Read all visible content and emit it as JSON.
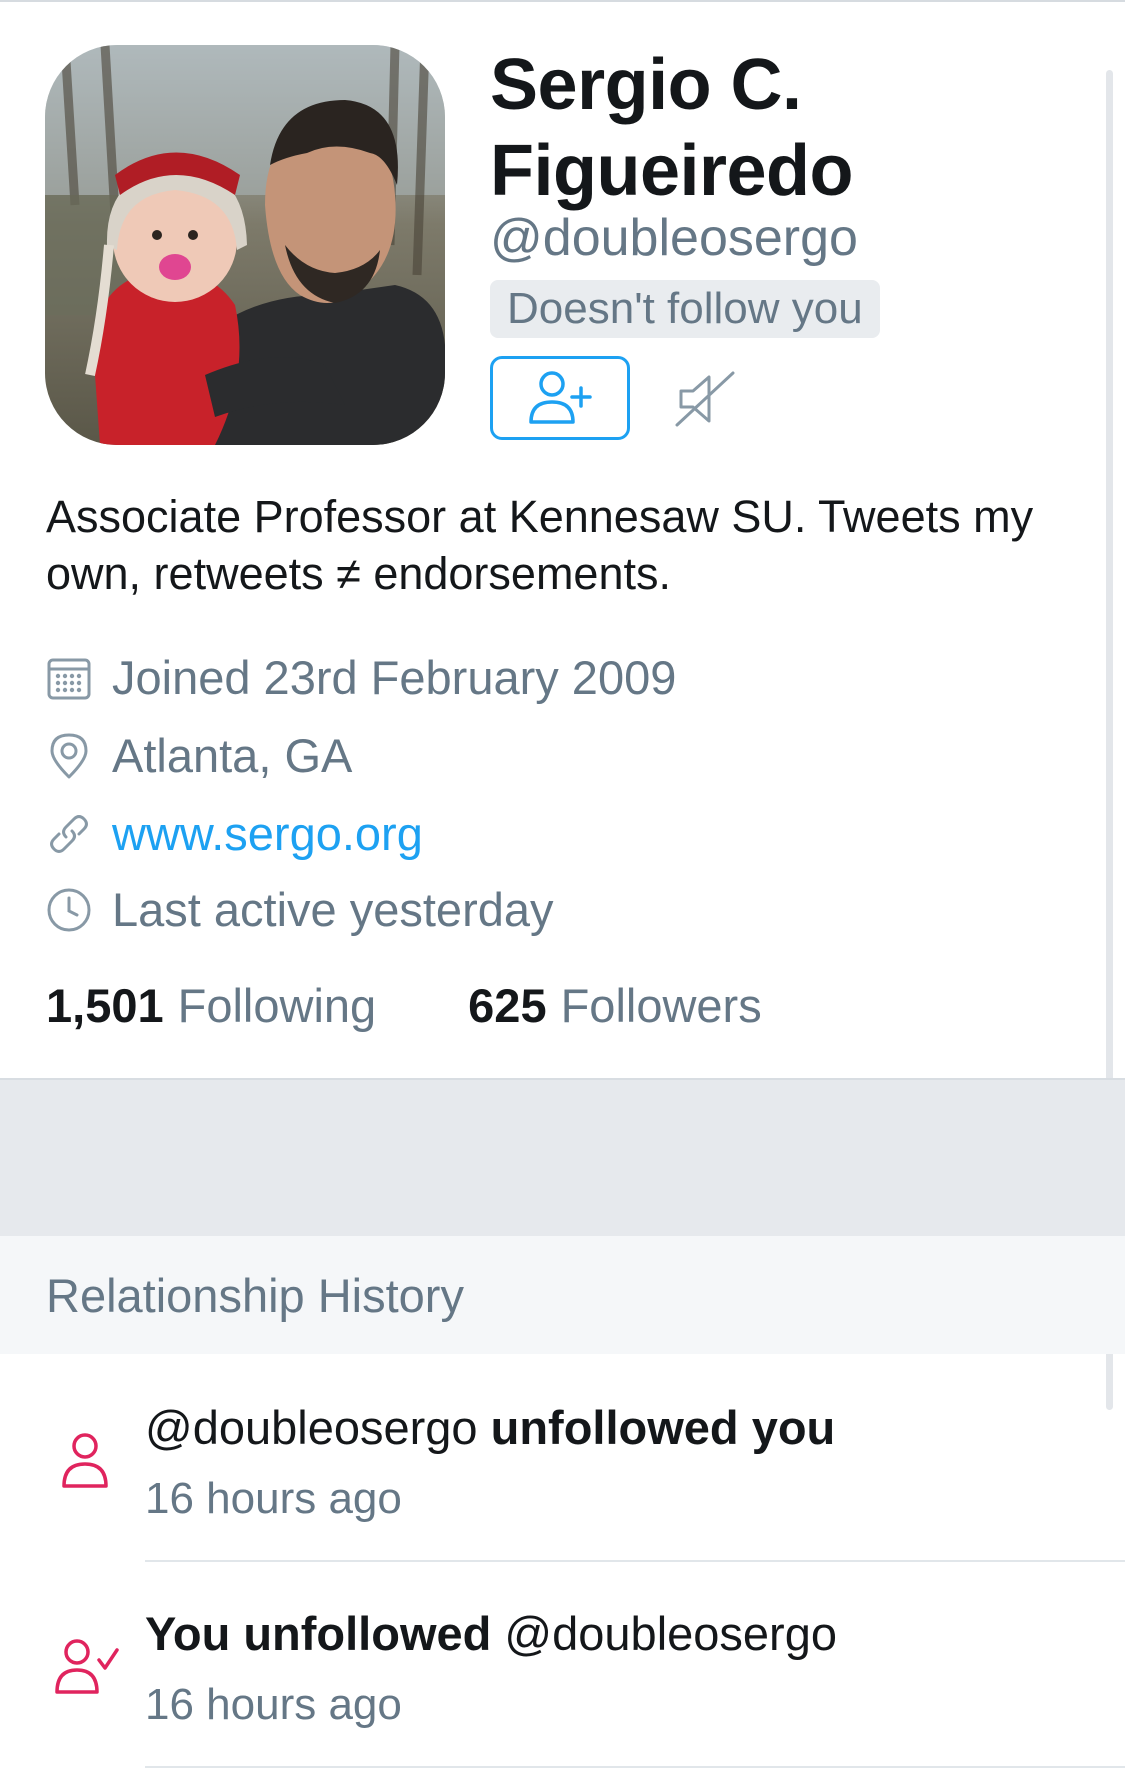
{
  "profile": {
    "name": "Sergio C. Figueiredo",
    "handle": "@doubleosergo",
    "relationship_badge": "Doesn't follow you",
    "bio": "Associate Professor at Kennesaw SU. Tweets my own, retweets ≠ endorsements.",
    "joined": "Joined 23rd February 2009",
    "location": "Atlanta, GA",
    "website": "www.sergo.org",
    "last_active": "Last active yesterday",
    "following_count": "1,501",
    "following_label": "Following",
    "followers_count": "625",
    "followers_label": "Followers"
  },
  "icons": {
    "follow": "add-user-icon",
    "mute": "muted-speaker-icon",
    "joined": "calendar-icon",
    "location": "location-pin-icon",
    "website": "link-icon",
    "last_active": "clock-icon"
  },
  "relationship_history": {
    "title": "Relationship History",
    "items": [
      {
        "icon": "user-icon",
        "handle": "@doubleosergo",
        "action": "unfollowed you",
        "time": "16 hours ago"
      },
      {
        "icon": "user-check-icon",
        "action": "You unfollowed",
        "handle": "@doubleosergo",
        "time": "16 hours ago"
      }
    ]
  },
  "colors": {
    "accent": "#1da1f2",
    "secondary_text": "#657786",
    "primary_text": "#14171a",
    "history_icon": "#e0245e",
    "band": "#e6e9ed"
  }
}
